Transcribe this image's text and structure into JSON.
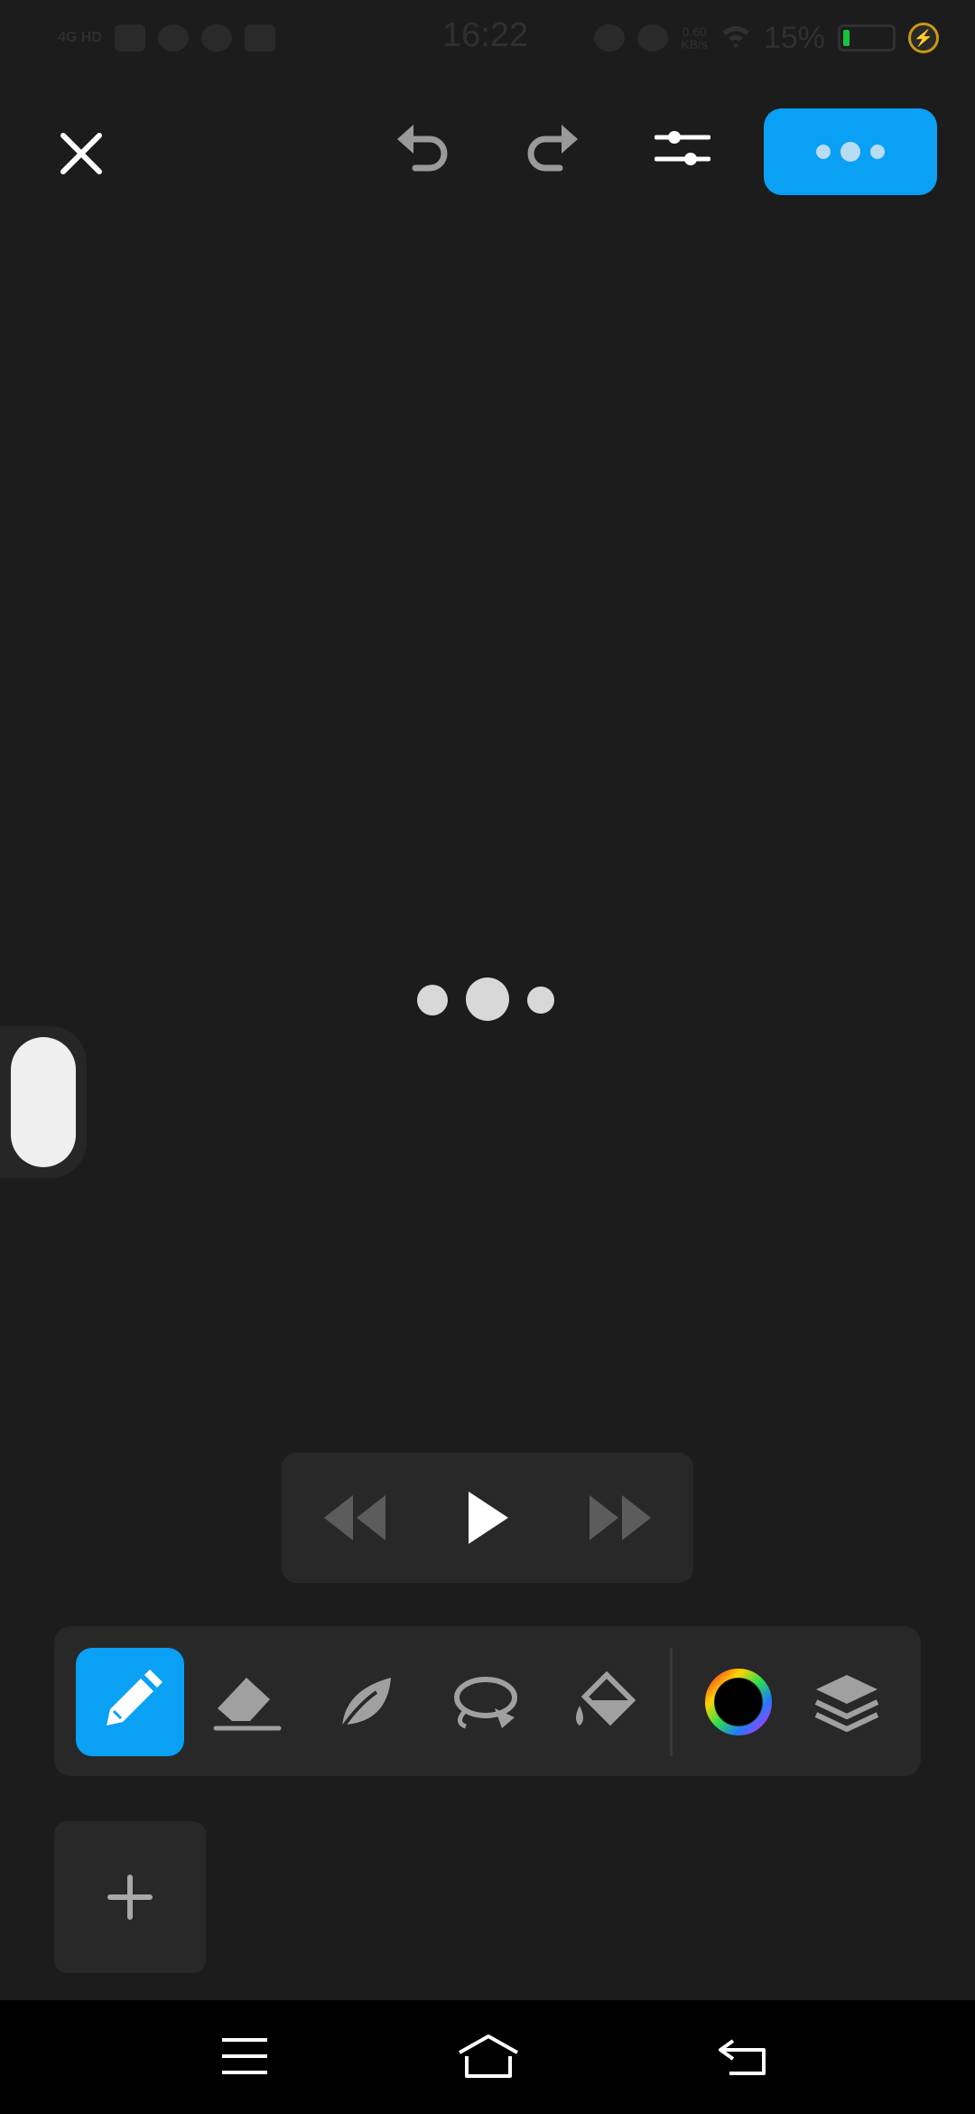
{
  "status_bar": {
    "network": "4G HD",
    "time": "16:22",
    "speed_value": "0.60",
    "speed_unit": "KB/s",
    "battery_percent": "15%"
  },
  "toolbar_top": {
    "icons": [
      "close-icon",
      "undo-icon",
      "redo-icon",
      "sliders-icon",
      "more-dots-icon"
    ]
  },
  "canvas": {
    "state": "loading"
  },
  "playback": {
    "icons": [
      "rewind-icon",
      "play-icon",
      "fast-forward-icon"
    ]
  },
  "tools": {
    "items": [
      "pencil",
      "eraser",
      "leaf-brush",
      "lasso",
      "fill-bucket",
      "color-wheel",
      "layers"
    ],
    "active": "pencil",
    "accent_color": "#0aa0f4"
  },
  "add_frame": {
    "icon": "plus-icon"
  },
  "nav_bar": {
    "icons": [
      "menu-icon",
      "home-icon",
      "back-icon"
    ]
  }
}
